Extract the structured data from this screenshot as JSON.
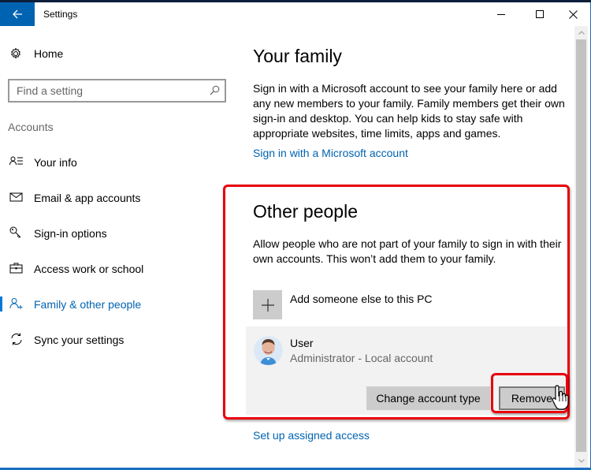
{
  "window": {
    "title": "Settings",
    "controls": {
      "minimize": "minimize",
      "maximize": "maximize",
      "close": "close"
    }
  },
  "sidebar": {
    "home_label": "Home",
    "search": {
      "placeholder": "Find a setting",
      "value": ""
    },
    "section_label": "Accounts",
    "items": [
      {
        "label": "Your info",
        "icon": "contact-list-icon",
        "active": false
      },
      {
        "label": "Email & app accounts",
        "icon": "mail-icon",
        "active": false
      },
      {
        "label": "Sign-in options",
        "icon": "key-icon",
        "active": false
      },
      {
        "label": "Access work or school",
        "icon": "briefcase-icon",
        "active": false
      },
      {
        "label": "Family & other people",
        "icon": "add-person-icon",
        "active": true
      },
      {
        "label": "Sync your settings",
        "icon": "sync-icon",
        "active": false
      }
    ]
  },
  "main": {
    "family": {
      "heading": "Your family",
      "description": "Sign in with a Microsoft account to see your family here or add any new members to your family. Family members get their own sign-in and desktop. You can help kids to stay safe with appropriate websites, time limits, apps and games.",
      "link": "Sign in with a Microsoft account"
    },
    "other_people": {
      "heading": "Other people",
      "description": "Allow people who are not part of your family to sign in with their own accounts. This won’t add them to your family.",
      "add_label": "Add someone else to this PC",
      "user": {
        "name": "User",
        "subtitle": "Administrator - Local account",
        "change_button": "Change account type",
        "remove_button": "Remove"
      }
    },
    "assigned_access_link": "Set up assigned access"
  },
  "colors": {
    "accent": "#0063b1",
    "annotation": "#e8000b",
    "card_bg": "#f2f2f2",
    "button_bg": "#cccccc"
  }
}
